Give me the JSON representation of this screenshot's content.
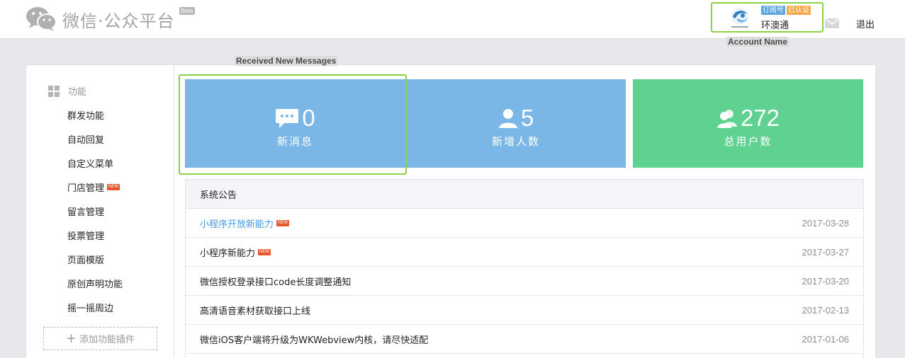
{
  "header": {
    "logo_text": "微信·公众平台",
    "beta_label": "Beta",
    "account": {
      "badge_subscription": "订阅号",
      "badge_verified": "已认证",
      "name": "环澳通"
    },
    "logout_label": "退出"
  },
  "annotations": {
    "account_name": "Account Name",
    "received_new_messages": "Received New Messages"
  },
  "sidebar": {
    "section_label": "功能",
    "items": [
      {
        "label": "群发功能",
        "new": false
      },
      {
        "label": "自动回复",
        "new": false
      },
      {
        "label": "自定义菜单",
        "new": false
      },
      {
        "label": "门店管理",
        "new": true
      },
      {
        "label": "留言管理",
        "new": false
      },
      {
        "label": "投票管理",
        "new": false
      },
      {
        "label": "页面模版",
        "new": false
      },
      {
        "label": "原创声明功能",
        "new": false
      },
      {
        "label": "摇一摇周边",
        "new": false
      }
    ],
    "new_badge": "NEW",
    "add_plugin_label": "添加功能插件"
  },
  "stats": [
    {
      "value": "0",
      "label": "新消息",
      "icon": "message-icon",
      "color": "#7ab6e6"
    },
    {
      "value": "5",
      "label": "新增人数",
      "icon": "user-icon",
      "color": "#7ab6e6"
    },
    {
      "value": "272",
      "label": "总用户数",
      "icon": "users-icon",
      "color": "#5fd191"
    }
  ],
  "announcements": {
    "title": "系统公告",
    "rows": [
      {
        "title": "小程序开放新能力",
        "date": "2017-03-28",
        "new": true,
        "link": true
      },
      {
        "title": "小程序新能力",
        "date": "2017-03-27",
        "new": true,
        "link": false
      },
      {
        "title": "微信授权登录接口code长度调整通知",
        "date": "2017-03-20",
        "new": false,
        "link": false
      },
      {
        "title": "高清语音素材获取接口上线",
        "date": "2017-02-13",
        "new": false,
        "link": false
      },
      {
        "title": "微信iOS客户端将升级为WKWebview内核，请尽快适配",
        "date": "2017-01-06",
        "new": false,
        "link": false
      }
    ]
  },
  "colors": {
    "accent_blue": "#7ab6e6",
    "accent_green": "#5fd191",
    "highlight": "#8ed145",
    "link": "#459ae9",
    "new_badge": "#e4572f"
  }
}
